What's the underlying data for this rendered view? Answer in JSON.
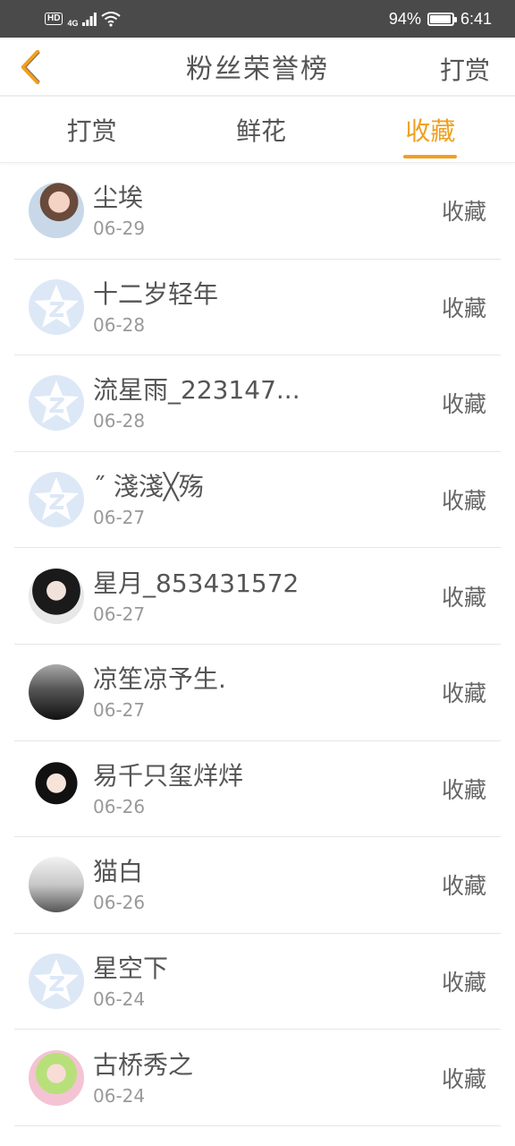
{
  "status_bar": {
    "hd": "HD",
    "network": "4G",
    "battery_percent_text": "94%",
    "battery_level": 0.94,
    "time": "6:41"
  },
  "header": {
    "title": "粉丝荣誉榜",
    "action": "打赏",
    "back_icon": "chevron-left-icon",
    "accent_color": "#f0a020"
  },
  "tabs": [
    {
      "label": "打赏",
      "active": false
    },
    {
      "label": "鲜花",
      "active": false
    },
    {
      "label": "收藏",
      "active": true
    }
  ],
  "fans": [
    {
      "name": "尘埃",
      "date": "06-29",
      "action": "收藏",
      "avatar": "photo"
    },
    {
      "name": "十二岁轻年",
      "date": "06-28",
      "action": "收藏",
      "avatar": "default-star"
    },
    {
      "name": "流星雨_223147...",
      "date": "06-28",
      "action": "收藏",
      "avatar": "default-star"
    },
    {
      "name": "˝ 淺淺╳殇",
      "date": "06-27",
      "action": "收藏",
      "avatar": "default-star"
    },
    {
      "name": "星月_853431572",
      "date": "06-27",
      "action": "收藏",
      "avatar": "photo"
    },
    {
      "name": "凉笙凉予生.",
      "date": "06-27",
      "action": "收藏",
      "avatar": "photo"
    },
    {
      "name": "易千只玺烊烊",
      "date": "06-26",
      "action": "收藏",
      "avatar": "photo"
    },
    {
      "name": "猫白",
      "date": "06-26",
      "action": "收藏",
      "avatar": "photo"
    },
    {
      "name": "星空下",
      "date": "06-24",
      "action": "收藏",
      "avatar": "default-star"
    },
    {
      "name": "古桥秀之",
      "date": "06-24",
      "action": "收藏",
      "avatar": "photo"
    }
  ]
}
